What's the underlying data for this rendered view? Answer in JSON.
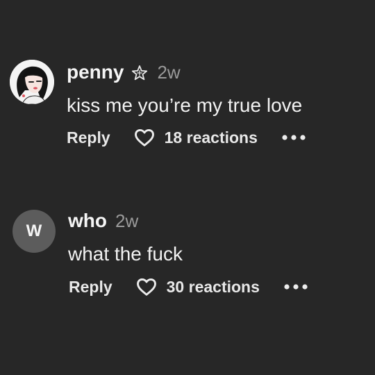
{
  "comments": [
    {
      "avatar_icon": "anime-girl-avatar-icon",
      "username": "penny",
      "badge_icon": "star-outline-icon",
      "timestamp": "2w",
      "text": "kiss me you’re my true love",
      "reply_label": "Reply",
      "reactions_label": "18 reactions"
    },
    {
      "avatar_initial": "W",
      "username": "who",
      "timestamp": "2w",
      "text": "what the fuck",
      "reply_label": "Reply",
      "reactions_label": "30 reactions"
    }
  ],
  "colors": {
    "background": "#272727",
    "text": "#f2f2f2",
    "muted": "#9a9a9a",
    "avatar_placeholder": "#5c5c5c"
  }
}
